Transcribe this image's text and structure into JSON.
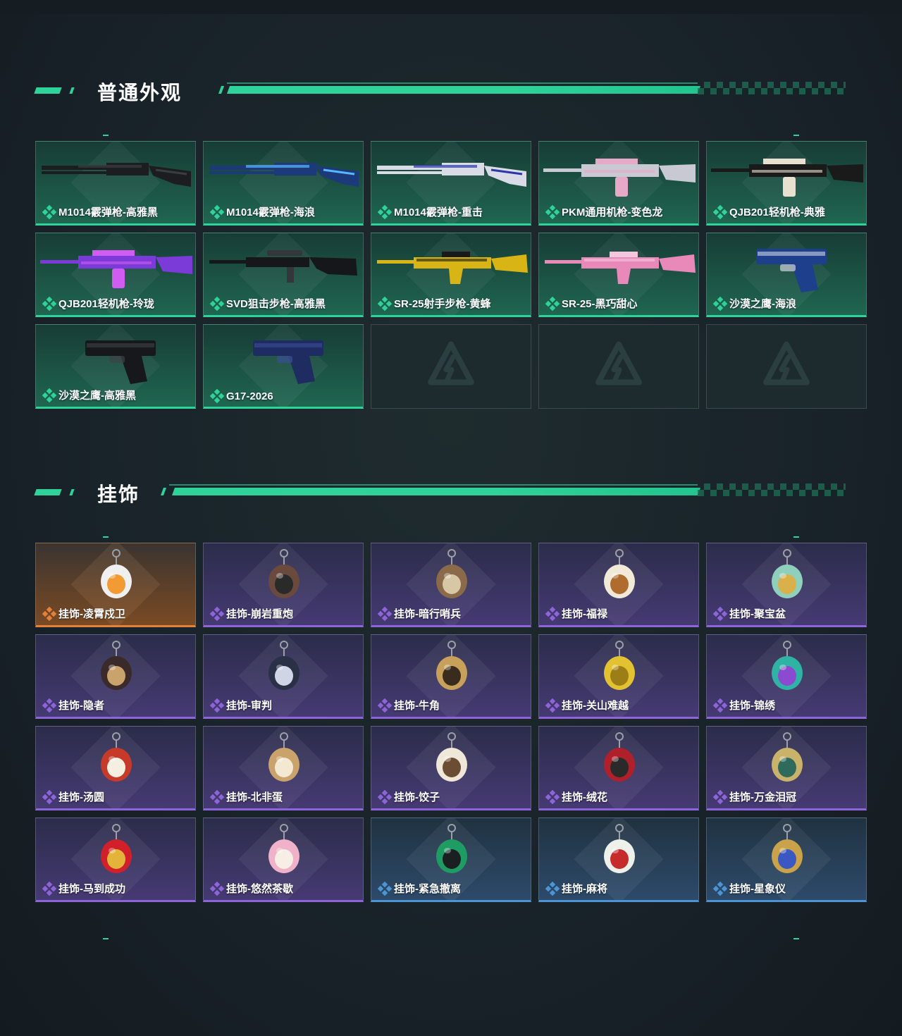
{
  "sections": [
    {
      "title": "普通外观",
      "items": [
        {
          "label": "M1014霰弹枪-高雅黑",
          "rarity": "green",
          "icon": "shotgun-icon",
          "colors": [
            "#1b1d20",
            "#3a3d42"
          ]
        },
        {
          "label": "M1014霰弹枪-海浪",
          "rarity": "green",
          "icon": "shotgun-icon",
          "colors": [
            "#1c3a7a",
            "#58b7ff"
          ]
        },
        {
          "label": "M1014霰弹枪-重击",
          "rarity": "green",
          "icon": "shotgun-icon",
          "colors": [
            "#d9dbe6",
            "#2b36a8"
          ]
        },
        {
          "label": "PKM通用机枪-变色龙",
          "rarity": "green",
          "icon": "machine-gun-icon",
          "colors": [
            "#c9c9d4",
            "#e6a9c8"
          ]
        },
        {
          "label": "QJB201轻机枪-典雅",
          "rarity": "green",
          "icon": "light-machine-gun-icon",
          "colors": [
            "#1a1a1a",
            "#e8e1cf"
          ]
        },
        {
          "label": "QJB201轻机枪-玲珑",
          "rarity": "green",
          "icon": "light-machine-gun-icon",
          "colors": [
            "#7b3bd8",
            "#d05cf2"
          ]
        },
        {
          "label": "SVD狙击步枪-高雅黑",
          "rarity": "green",
          "icon": "sniper-rifle-icon",
          "colors": [
            "#15171a",
            "#33363b"
          ]
        },
        {
          "label": "SR-25射手步枪-黄蜂",
          "rarity": "green",
          "icon": "marksman-rifle-icon",
          "colors": [
            "#d8b415",
            "#1a1a1a"
          ]
        },
        {
          "label": "SR-25-黑巧甜心",
          "rarity": "green",
          "icon": "marksman-rifle-icon",
          "colors": [
            "#e889b9",
            "#f4c6dd"
          ]
        },
        {
          "label": "沙漠之鹰-海浪",
          "rarity": "green",
          "icon": "pistol-icon",
          "colors": [
            "#1d3f8c",
            "#cfd3df"
          ]
        },
        {
          "label": "沙漠之鹰-高雅黑",
          "rarity": "green",
          "icon": "pistol-icon",
          "colors": [
            "#16181b",
            "#3e4247"
          ]
        },
        {
          "label": "G17-2026",
          "rarity": "green",
          "icon": "pistol-icon",
          "colors": [
            "#1e2c62",
            "#3b4f94"
          ]
        },
        {
          "empty": true,
          "icon": "empty-slot-logo-icon"
        },
        {
          "empty": true,
          "icon": "empty-slot-logo-icon"
        },
        {
          "empty": true,
          "icon": "empty-slot-logo-icon"
        }
      ]
    },
    {
      "title": "挂饰",
      "items": [
        {
          "label": "挂饰-凌霄戍卫",
          "rarity": "orange",
          "icon": "rocket-charm-icon",
          "colors": [
            "#f0f0f0",
            "#f29b35"
          ]
        },
        {
          "label": "挂饰-崩岩重炮",
          "rarity": "purple",
          "icon": "figure-charm-icon",
          "colors": [
            "#6a4a3c",
            "#2a2a2a"
          ]
        },
        {
          "label": "挂饰-暗行哨兵",
          "rarity": "purple",
          "icon": "figure-charm-icon",
          "colors": [
            "#8a6a48",
            "#d8c7a5"
          ]
        },
        {
          "label": "挂饰-福禄",
          "rarity": "purple",
          "icon": "gourd-charm-icon",
          "colors": [
            "#f2ead8",
            "#b06b2f"
          ]
        },
        {
          "label": "挂饰-聚宝盆",
          "rarity": "purple",
          "icon": "treasure-bowl-charm-icon",
          "colors": [
            "#8fd0bd",
            "#d9b04a"
          ]
        },
        {
          "label": "挂饰-隐者",
          "rarity": "purple",
          "icon": "tarot-card-charm-icon",
          "colors": [
            "#3a2a2a",
            "#c9a36b"
          ]
        },
        {
          "label": "挂饰-审判",
          "rarity": "purple",
          "icon": "tarot-card-charm-icon",
          "colors": [
            "#2a3046",
            "#d0d5e6"
          ]
        },
        {
          "label": "挂饰-牛角",
          "rarity": "purple",
          "icon": "horn-charm-icon",
          "colors": [
            "#c7a15a",
            "#3a2c1c"
          ]
        },
        {
          "label": "挂饰-关山难越",
          "rarity": "purple",
          "icon": "gold-bar-charm-icon",
          "colors": [
            "#e3c232",
            "#9c7d16"
          ]
        },
        {
          "label": "挂饰-锦绣",
          "rarity": "purple",
          "icon": "butterfly-charm-icon",
          "colors": [
            "#2fb3a5",
            "#8a4bd0"
          ]
        },
        {
          "label": "挂饰-汤圆",
          "rarity": "purple",
          "icon": "bowl-charm-icon",
          "colors": [
            "#c73a2a",
            "#f5efe2"
          ]
        },
        {
          "label": "挂饰-北非蛋",
          "rarity": "purple",
          "icon": "bowl-charm-icon",
          "colors": [
            "#c9a36b",
            "#f3e9d2"
          ]
        },
        {
          "label": "挂饰-饺子",
          "rarity": "purple",
          "icon": "dumpling-charm-icon",
          "colors": [
            "#efe7d8",
            "#6b4d33"
          ]
        },
        {
          "label": "挂饰-绒花",
          "rarity": "purple",
          "icon": "flower-charm-icon",
          "colors": [
            "#b0202a",
            "#2a2a2a"
          ]
        },
        {
          "label": "挂饰-万金泪冠",
          "rarity": "purple",
          "icon": "crown-charm-icon",
          "colors": [
            "#c9b36a",
            "#2e6b5c"
          ]
        },
        {
          "label": "挂饰-马到成功",
          "rarity": "purple",
          "icon": "horse-charm-icon",
          "colors": [
            "#d2202a",
            "#e4b43a"
          ]
        },
        {
          "label": "挂饰-悠然茶歇",
          "rarity": "purple",
          "icon": "cupcake-charm-icon",
          "colors": [
            "#f0b2c8",
            "#f7eee5"
          ]
        },
        {
          "label": "挂饰-紧急撤离",
          "rarity": "blue",
          "icon": "emergency-sign-charm-icon",
          "colors": [
            "#1f9c63",
            "#1a1f22"
          ]
        },
        {
          "label": "挂饰-麻将",
          "rarity": "blue",
          "icon": "mahjong-tile-charm-icon",
          "colors": [
            "#eef0ea",
            "#c72c2c"
          ]
        },
        {
          "label": "挂饰-星象仪",
          "rarity": "blue",
          "icon": "astrolabe-charm-icon",
          "colors": [
            "#c9a24a",
            "#3b58c2"
          ]
        }
      ]
    }
  ],
  "rarity_colors": {
    "green": "#2fd39a",
    "purple": "#8d65d9",
    "orange": "#e2823a",
    "blue": "#4b94d6"
  }
}
